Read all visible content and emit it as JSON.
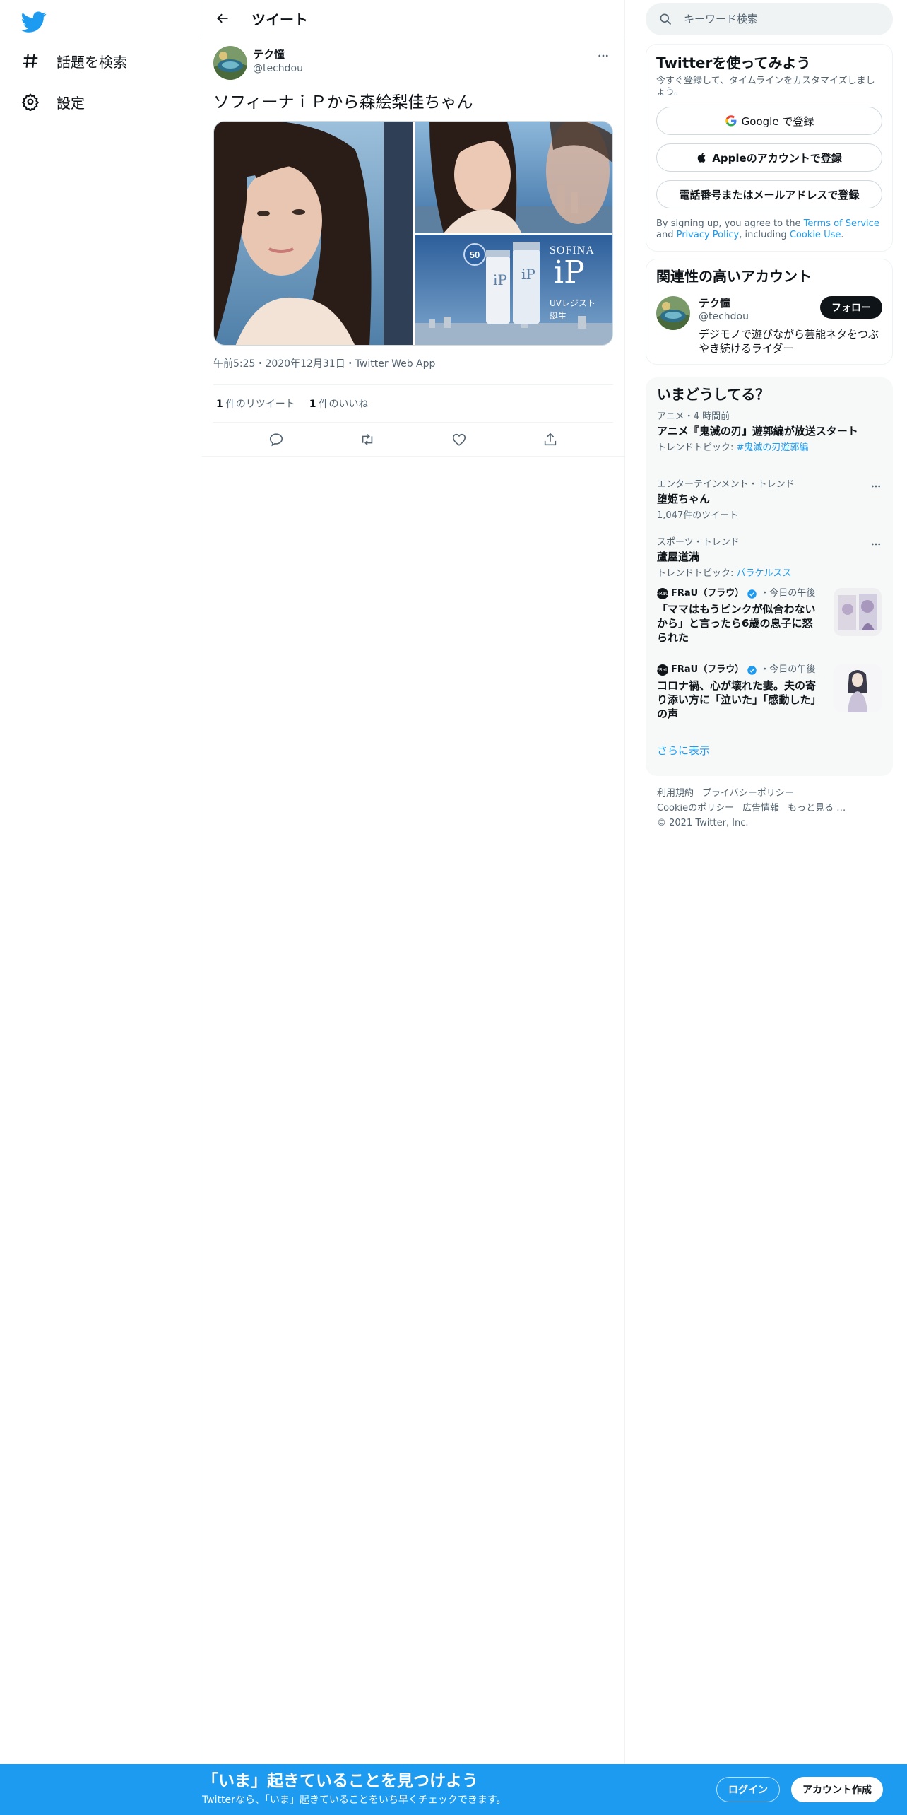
{
  "nav": {
    "explore_label": "話題を検索",
    "settings_label": "設定"
  },
  "header": {
    "title": "ツイート"
  },
  "tweet": {
    "author_name": "テク憧",
    "author_handle": "@techdou",
    "text": "ソフィーナｉＰから森絵梨佳ちゃん",
    "media_overlay": {
      "product_badge": "50",
      "brand": "SOFINA",
      "logo": "iP",
      "caption_line1": "UVレジスト",
      "caption_line2": "誕生"
    },
    "meta": "午前5:25・2020年12月31日・Twitter Web App",
    "retweets_count": "1",
    "retweets_label": "件のリツイート",
    "likes_count": "1",
    "likes_label": "件のいいね"
  },
  "search": {
    "placeholder": "キーワード検索"
  },
  "signup_card": {
    "title": "Twitterを使ってみよう",
    "subtitle": "今すぐ登録して、タイムラインをカスタマイズしましょう。",
    "google_label": "Google で登録",
    "apple_label": "Appleのアカウントで登録",
    "phone_label": "電話番号またはメールアドレスで登録",
    "terms_prefix": "By signing up, you agree to the ",
    "terms_link": "Terms of Service",
    "terms_and": " and ",
    "privacy_link": "Privacy Policy",
    "terms_including": ", including ",
    "cookie_link": "Cookie Use",
    "terms_end": "."
  },
  "related": {
    "title": "関連性の高いアカウント",
    "name": "テク憧",
    "handle": "@techdou",
    "bio": "デジモノで遊びながら芸能ネタをつぶやき続けるライダー",
    "follow_label": "フォロー"
  },
  "trends": {
    "title": "いまどうしてる？",
    "items": [
      {
        "context": "アニメ・4 時間前",
        "title": "アニメ『鬼滅の刃』遊郭編が放送スタート",
        "foot_prefix": "トレンドトピック: ",
        "foot_link": "#鬼滅の刃遊郭編"
      },
      {
        "context": "エンターテインメント・トレンド",
        "title": "堕姫ちゃん",
        "foot_prefix": "1,047件のツイート",
        "foot_link": ""
      },
      {
        "context": "スポーツ・トレンド",
        "title": "蘆屋道満",
        "foot_prefix": "トレンドトピック: ",
        "foot_link": "パラケルスス"
      }
    ],
    "news": [
      {
        "source": "FRaU（フラウ）",
        "source_logo": "FRaU",
        "time": "・今日の午後",
        "title": "「ママはもうピンクが似合わないから」と言ったら6歳の息子に怒られた"
      },
      {
        "source": "FRaU（フラウ）",
        "source_logo": "FRaU",
        "time": "・今日の午後",
        "title": "コロナ禍、心が壊れた妻。夫の寄り添い方に「泣いた」「感動した」の声"
      }
    ],
    "show_more": "さらに表示"
  },
  "footer": {
    "terms": "利用規約",
    "privacy": "プライバシーポリシー",
    "cookie": "Cookieのポリシー",
    "ads": "広告情報",
    "more": "もっと見る …",
    "copyright": "© 2021 Twitter, Inc."
  },
  "bottom_bar": {
    "title": "「いま」起きていることを見つけよう",
    "subtitle": "Twitterなら、「いま」起きていることをいち早くチェックできます。",
    "login_label": "ログイン",
    "signup_label": "アカウント作成"
  },
  "colors": {
    "accent": "#1d9bf0",
    "text": "#0f1419",
    "muted": "#536471"
  }
}
